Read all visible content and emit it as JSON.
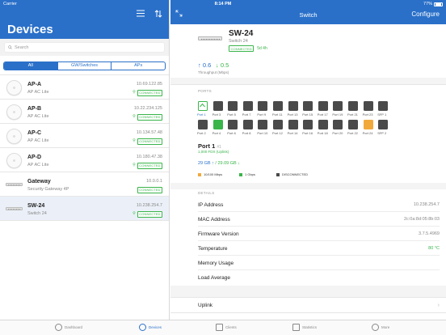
{
  "status_bar": {
    "carrier": "Carrier",
    "time": "8:14 PM",
    "battery": "77%"
  },
  "colors": {
    "accent": "#2a70c9",
    "connected": "#39b54a",
    "tenmeg": "#f2a93b",
    "disconnected": "#4a4a4a"
  },
  "left": {
    "title": "Devices",
    "search_placeholder": "Search",
    "filters": [
      "All",
      "GW/Switches",
      "APs"
    ],
    "devices": [
      {
        "name": "AP-A",
        "model": "AP AC Lite",
        "ip": "10.69.122.85",
        "status": "CONNECTED",
        "type": "ap"
      },
      {
        "name": "AP-B",
        "model": "AP AC Lite",
        "ip": "10.22.234.125",
        "status": "CONNECTED",
        "type": "ap"
      },
      {
        "name": "AP-C",
        "model": "AP AC Lite",
        "ip": "10.134.57.48",
        "status": "CONNECTED",
        "type": "ap"
      },
      {
        "name": "AP-D",
        "model": "AP AC Lite",
        "ip": "10.180.47.38",
        "status": "CONNECTED",
        "type": "ap"
      },
      {
        "name": "Gateway",
        "model": "Security Gateway 4P",
        "ip": "10.0.0.1",
        "status": "CONNECTED",
        "type": "gateway"
      },
      {
        "name": "SW-24",
        "model": "Switch 24",
        "ip": "10.238.254.7",
        "status": "CONNECTED",
        "type": "switch"
      }
    ]
  },
  "right": {
    "title": "Switch",
    "configure": "Configure",
    "device": {
      "name": "SW-24",
      "model": "Switch 24",
      "status": "CONNECTED",
      "uptime": "5d 4h",
      "tx": "↑ 0.6",
      "rx": "↓ 0.5",
      "throughput_label": "Throughput (Mbps)"
    },
    "ports_label": "PORTS",
    "ports": [
      {
        "label": "Port 1",
        "state": "selected"
      },
      {
        "label": "Port 3",
        "state": "disconnected"
      },
      {
        "label": "Port 5",
        "state": "disconnected"
      },
      {
        "label": "Port 7",
        "state": "disconnected"
      },
      {
        "label": "Port 9",
        "state": "disconnected"
      },
      {
        "label": "Port 11",
        "state": "disconnected"
      },
      {
        "label": "Port 13",
        "state": "disconnected"
      },
      {
        "label": "Port 15",
        "state": "disconnected"
      },
      {
        "label": "Port 17",
        "state": "disconnected"
      },
      {
        "label": "Port 19",
        "state": "disconnected"
      },
      {
        "label": "Port 21",
        "state": "disconnected"
      },
      {
        "label": "Port 23",
        "state": "disconnected"
      },
      {
        "label": "SFP 1",
        "state": "disconnected"
      },
      {
        "label": "Port 2",
        "state": "disconnected"
      },
      {
        "label": "Port 4",
        "state": "gigabit"
      },
      {
        "label": "Port 6",
        "state": "disconnected"
      },
      {
        "label": "Port 8",
        "state": "disconnected"
      },
      {
        "label": "Port 10",
        "state": "disconnected"
      },
      {
        "label": "Port 12",
        "state": "disconnected"
      },
      {
        "label": "Port 14",
        "state": "disconnected"
      },
      {
        "label": "Port 16",
        "state": "disconnected"
      },
      {
        "label": "Port 18",
        "state": "disconnected"
      },
      {
        "label": "Port 20",
        "state": "disconnected"
      },
      {
        "label": "Port 22",
        "state": "disconnected"
      },
      {
        "label": "Port 24",
        "state": "tenmeg"
      },
      {
        "label": "SFP 2",
        "state": "disconnected"
      }
    ],
    "port_detail": {
      "title": "Port 1",
      "number": "#1",
      "speed": "1,000 FDX (Uplink)",
      "traffic_tx": "29 GB ↑",
      "traffic_rx": "/ 29.09 GB ↓"
    },
    "legend": [
      {
        "label": "10/100 Mbps",
        "color": "#f2a93b"
      },
      {
        "label": "1 Gbps",
        "color": "#39b54a"
      },
      {
        "label": "DISCONNECTED",
        "color": "#4a4a4a"
      }
    ],
    "details_label": "DETAILS",
    "details": [
      {
        "key": "IP Address",
        "value": "10.238.254.7"
      },
      {
        "key": "MAC Address",
        "value": "2c:0a:8d:05:8b:03"
      },
      {
        "key": "Firmware Version",
        "value": "3.7.5.4969"
      },
      {
        "key": "Temperature",
        "value": "80 °C"
      },
      {
        "key": "Memory Usage",
        "value": ""
      },
      {
        "key": "Load Average",
        "value": ""
      }
    ],
    "uplink_label": "Uplink"
  },
  "tabs": [
    "Dashboard",
    "Devices",
    "Clients",
    "Statistics",
    "More"
  ]
}
